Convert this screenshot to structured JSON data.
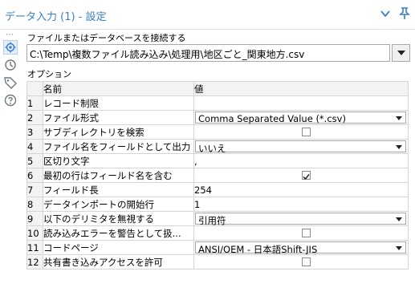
{
  "window": {
    "title": "データ入力 (1) - 設定",
    "icons": [
      "chevron-down-icon",
      "pin-icon"
    ]
  },
  "sidebar": {
    "dots": "⋯",
    "icons": [
      "gear-icon",
      "refresh-icon",
      "tag-icon",
      "help-icon"
    ]
  },
  "file": {
    "label": "ファイルまたはデータベースを接続する",
    "path": "C:\\Temp\\複数ファイル読み込み\\処理用\\地区ごと_関東地方.csv"
  },
  "options": {
    "label": "オプション",
    "headers": {
      "num": "",
      "name": "名前",
      "value": "値"
    },
    "rows": [
      {
        "num": "1",
        "name": "レコード制限",
        "value": "",
        "type": "text"
      },
      {
        "num": "2",
        "name": "ファイル形式",
        "value": "Comma Separated Value (*.csv)",
        "type": "select"
      },
      {
        "num": "3",
        "name": "サブディレクトリを検索",
        "value": "",
        "type": "checkbox",
        "checked": false
      },
      {
        "num": "4",
        "name": "ファイル名をフィールドとして出力",
        "value": "いいえ",
        "type": "select"
      },
      {
        "num": "5",
        "name": "区切り文字",
        "value": ",",
        "type": "text"
      },
      {
        "num": "6",
        "name": "最初の行はフィールド名を含む",
        "value": "",
        "type": "checkbox",
        "checked": true
      },
      {
        "num": "7",
        "name": "フィールド長",
        "value": "254",
        "type": "text"
      },
      {
        "num": "8",
        "name": "データインポートの開始行",
        "value": "1",
        "type": "text"
      },
      {
        "num": "9",
        "name": "以下のデリミタを無視する",
        "value": "引用符",
        "type": "select"
      },
      {
        "num": "10",
        "name": "読み込みエラーを警告として扱...",
        "value": "",
        "type": "checkbox",
        "checked": false
      },
      {
        "num": "11",
        "name": "コードページ",
        "value": "ANSI/OEM - 日本語Shift-JIS",
        "type": "select"
      },
      {
        "num": "12",
        "name": "共有書き込みアクセスを許可",
        "value": "",
        "type": "checkbox",
        "checked": false
      }
    ]
  },
  "colors": {
    "accent": "#3b7fc4",
    "header_bg": "#f3f3f3",
    "grid_line": "#d5d5d5"
  }
}
